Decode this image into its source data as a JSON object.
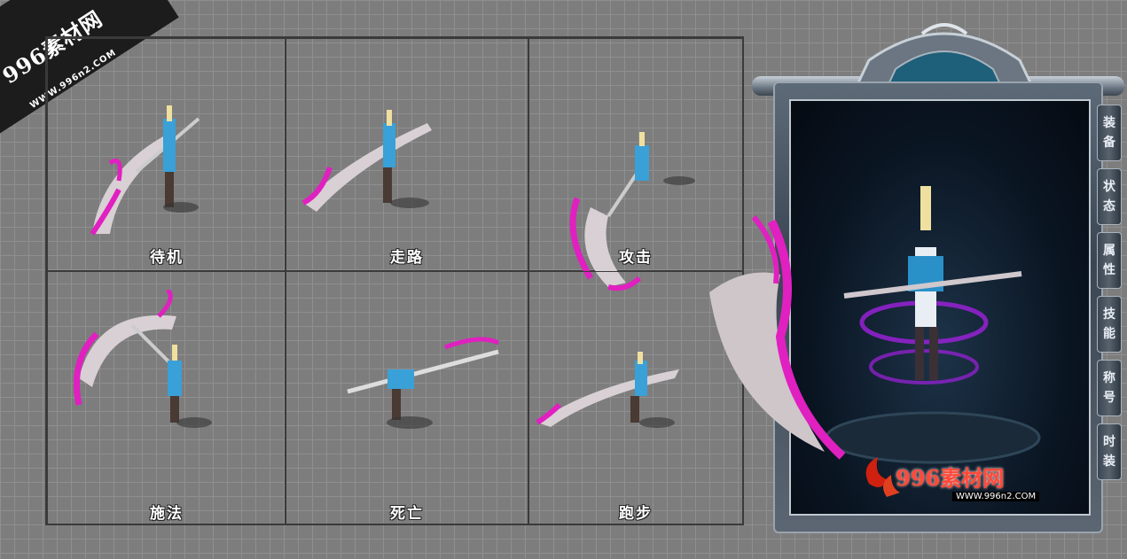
{
  "watermark": {
    "title": "996素材网",
    "url": "WWW.996n2.COM"
  },
  "frames": [
    {
      "id": "idle",
      "label": "待机"
    },
    {
      "id": "walk",
      "label": "走路"
    },
    {
      "id": "attack",
      "label": "攻击"
    },
    {
      "id": "cast",
      "label": "施法"
    },
    {
      "id": "death",
      "label": "死亡"
    },
    {
      "id": "run",
      "label": "跑步"
    }
  ],
  "panel": {
    "tabs": [
      {
        "id": "equip",
        "chars": [
          "装",
          "备"
        ]
      },
      {
        "id": "status",
        "chars": [
          "状",
          "态"
        ]
      },
      {
        "id": "attributes",
        "chars": [
          "属",
          "性"
        ]
      },
      {
        "id": "skills",
        "chars": [
          "技",
          "能"
        ]
      },
      {
        "id": "title",
        "chars": [
          "称",
          "号"
        ]
      },
      {
        "id": "fashion",
        "chars": [
          "时",
          "装"
        ]
      }
    ],
    "logo_text": "996素材网",
    "logo_url": "WWW.996n2.COM"
  },
  "colors": {
    "accent": "#e020c0",
    "panel_border": "#c0c8d0"
  }
}
